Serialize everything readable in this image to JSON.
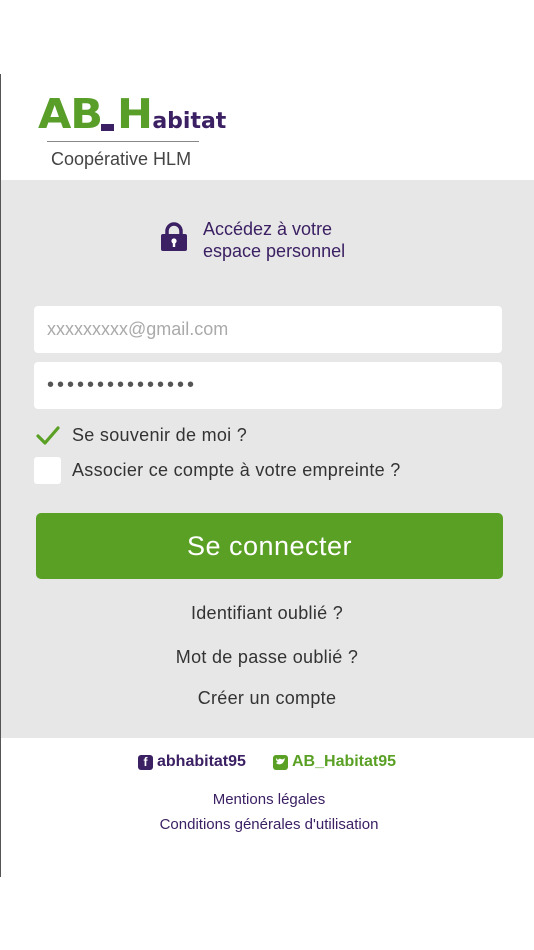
{
  "brand": {
    "logo_main": "AB",
    "logo_h": "H",
    "logo_sub": "abitat",
    "tagline": "Coopérative HLM",
    "green": "#5aa024",
    "purple": "#3b2063"
  },
  "login": {
    "intro_line1": "Accédez à votre",
    "intro_line2": "espace personnel",
    "email_placeholder": "xxxxxxxxx@gmail.com",
    "password_value": "•••••••••••••••",
    "remember_label": "Se souvenir de moi ?",
    "remember_checked": true,
    "fingerprint_label": "Associer ce compte à votre empreinte ?",
    "fingerprint_checked": false,
    "submit_label": "Se connecter"
  },
  "links": {
    "forgot_id": "Identifiant oublié ?",
    "forgot_password": "Mot de passe oublié ?",
    "create_account": "Créer un compte"
  },
  "footer": {
    "facebook": "abhabitat95",
    "twitter": "AB_Habitat95",
    "legal": "Mentions légales",
    "terms": "Conditions générales d'utilisation"
  },
  "icons": {
    "lock": "lock-icon",
    "check": "checkmark-icon",
    "facebook": "facebook-icon",
    "twitter": "twitter-icon"
  }
}
